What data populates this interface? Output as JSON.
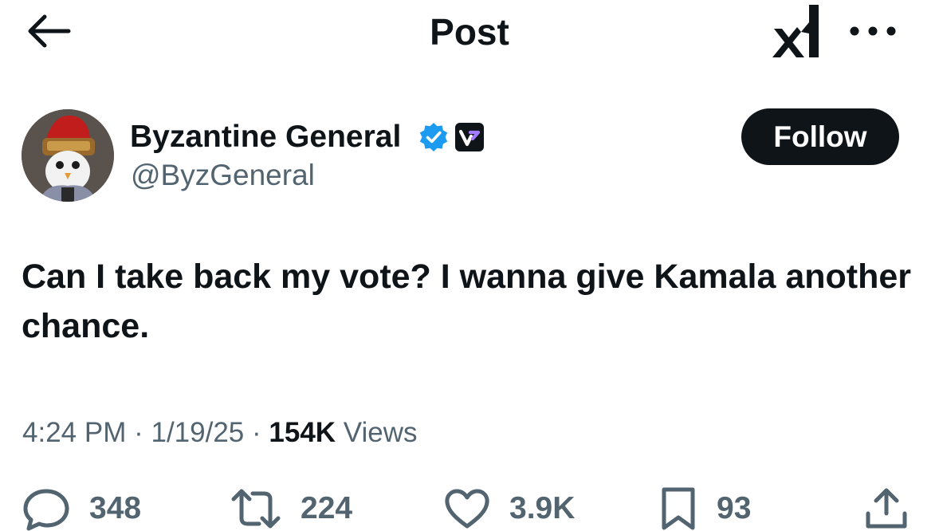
{
  "header": {
    "title": "Post",
    "back_icon": "arrow-left-icon",
    "grok_icon": "grok-logo-icon",
    "more_icon": "more-horizontal-icon"
  },
  "author": {
    "name": "Byzantine General",
    "handle": "@ByzGeneral",
    "avatar": "avatar-penguin-gladiator",
    "verified_icon": "verified-badge-icon",
    "affiliate_icon": "affiliate-badge-icon"
  },
  "follow": {
    "label": "Follow"
  },
  "post": {
    "text": "Can I take back my vote? I wanna give Kamala another chance.",
    "time": "4:24 PM",
    "sep1": "·",
    "date": "1/19/25",
    "sep2": "·",
    "views_count": "154K",
    "views_label": "Views"
  },
  "actions": {
    "replies": "348",
    "reposts": "224",
    "likes": "3.9K",
    "bookmarks": "93"
  },
  "colors": {
    "text": "#0f1419",
    "secondary": "#536471",
    "verified": "#1d9bf0",
    "follow_bg": "#0f1419"
  }
}
